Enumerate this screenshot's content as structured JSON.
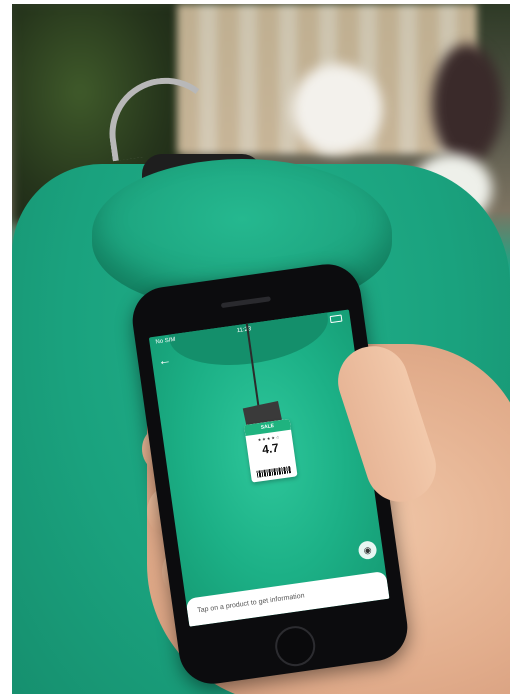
{
  "phone": {
    "status": {
      "carrier": "No SIM",
      "time": "11:23"
    },
    "tag": {
      "label": "SALE",
      "stars": "★★★★☆",
      "rating": "4.7"
    },
    "info_bar": {
      "text": "Tap on a product to get information"
    }
  },
  "icons": [
    "back-arrow-icon",
    "camera-icon",
    "battery-icon"
  ],
  "colors": {
    "sweater": "#1aa47f",
    "tag_header": "#1fb37f",
    "phone_body": "#0c0c0e"
  }
}
